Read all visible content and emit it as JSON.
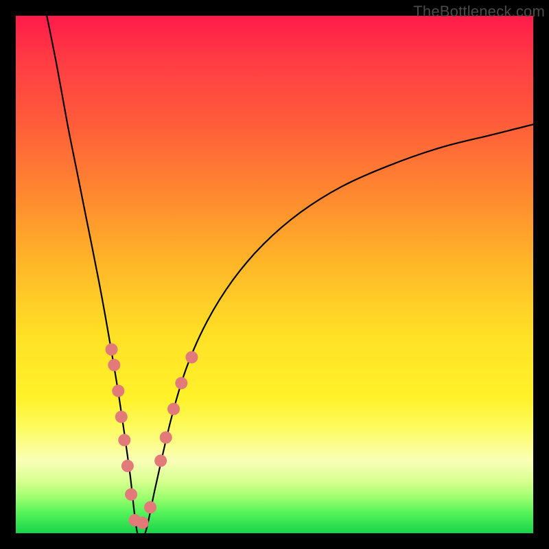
{
  "watermark": "TheBottleneck.com",
  "chart_data": {
    "type": "line",
    "title": "",
    "xlabel": "",
    "ylabel": "",
    "xlim": [
      0,
      100
    ],
    "ylim": [
      0,
      100
    ],
    "series": [
      {
        "name": "curve",
        "x": [
          6,
          8,
          10,
          12,
          14,
          16,
          18,
          20,
          22,
          23.5,
          25,
          27,
          30,
          33,
          37,
          42,
          48,
          55,
          63,
          72,
          82,
          92,
          100
        ],
        "y": [
          100,
          90,
          79,
          69,
          59,
          49,
          38,
          26,
          12,
          0,
          0,
          9,
          22,
          32,
          41,
          49,
          56,
          62,
          67,
          71,
          74.5,
          77,
          79
        ]
      }
    ],
    "markers": {
      "name": "dots",
      "color": "#e27a7a",
      "radius_px": 9,
      "points": [
        {
          "x": 18.5,
          "y": 35.5
        },
        {
          "x": 19.0,
          "y": 32.5
        },
        {
          "x": 19.8,
          "y": 27.5
        },
        {
          "x": 20.4,
          "y": 22.5
        },
        {
          "x": 21.0,
          "y": 18.0
        },
        {
          "x": 21.6,
          "y": 13.0
        },
        {
          "x": 22.3,
          "y": 7.5
        },
        {
          "x": 23.0,
          "y": 2.5
        },
        {
          "x": 24.5,
          "y": 2.0
        },
        {
          "x": 26.0,
          "y": 5.0
        },
        {
          "x": 28.0,
          "y": 14.0
        },
        {
          "x": 29.0,
          "y": 18.5
        },
        {
          "x": 30.5,
          "y": 24.0
        },
        {
          "x": 32.0,
          "y": 29.0
        },
        {
          "x": 34.0,
          "y": 34.0
        }
      ]
    }
  }
}
